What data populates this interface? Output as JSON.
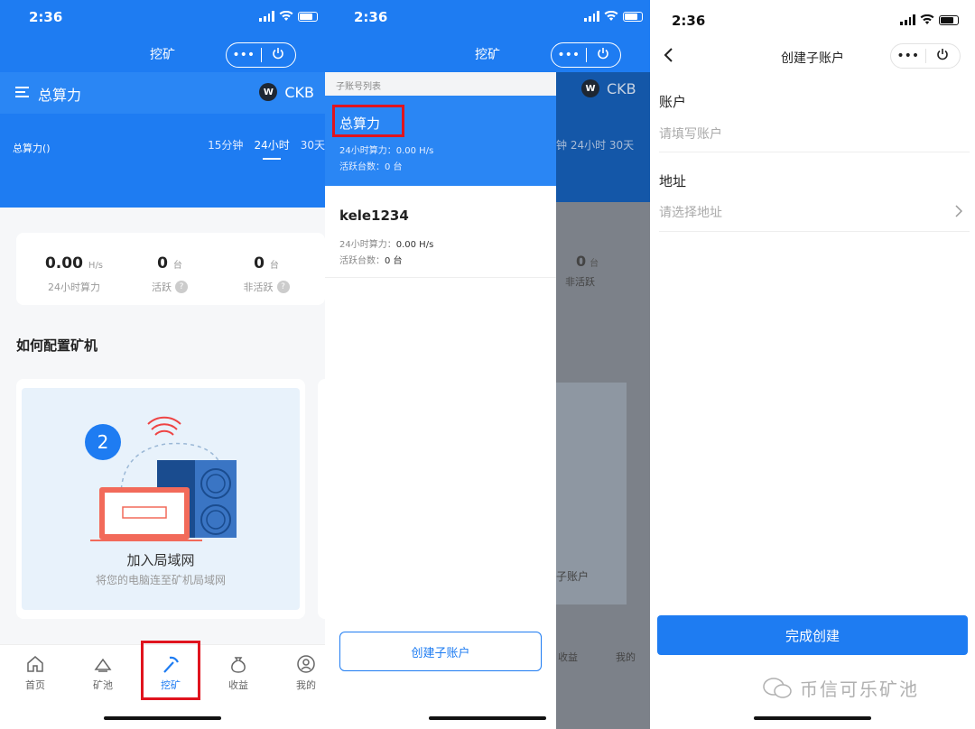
{
  "colors": {
    "primary": "#1e7cf2",
    "highlight": "#e0141e"
  },
  "status": {
    "time": "2:36"
  },
  "panel1": {
    "nav_title": "挖矿",
    "capsule_more": "•••",
    "topbar": {
      "title": "总算力",
      "coin": "CKB"
    },
    "hash_label": "总算力()",
    "time_tabs": [
      "15分钟",
      "24小时",
      "30天"
    ],
    "stats": [
      {
        "value": "0.00",
        "unit": "H/s",
        "label": "24小时算力"
      },
      {
        "value": "0",
        "unit": "台",
        "label": "活跃"
      },
      {
        "value": "0",
        "unit": "台",
        "label": "非活跃"
      }
    ],
    "section_title": "如何配置矿机",
    "guide": {
      "step": "2",
      "title": "加入局域网",
      "subtitle": "将您的电脑连至矿机局域网"
    },
    "tabbar": [
      {
        "label": "首页",
        "icon": "home-icon"
      },
      {
        "label": "矿池",
        "icon": "pool-icon"
      },
      {
        "label": "挖矿",
        "icon": "pickaxe-icon"
      },
      {
        "label": "收益",
        "icon": "money-bag-icon"
      },
      {
        "label": "我的",
        "icon": "user-icon"
      }
    ]
  },
  "panel2": {
    "nav_title": "挖矿",
    "drawer_title": "子账号列表",
    "accounts": [
      {
        "name": "总算力",
        "hash_label": "24小时算力：",
        "hash": "0.00 H/s",
        "active_label": "活跃台数：",
        "active": "0 台"
      },
      {
        "name": "kele1234",
        "hash_label": "24小时算力：",
        "hash": "0.00 H/s",
        "active_label": "活跃台数：",
        "active": "0 台"
      }
    ],
    "create_btn": "创建子账户",
    "overlay": {
      "coin": "CKB",
      "tabs": "钟 24小时 30天",
      "num": "0",
      "unit": "台",
      "lab": "非活跃",
      "text": "子账户",
      "tab1": "收益",
      "tab2": "我的"
    }
  },
  "panel3": {
    "nav_title": "创建子账户",
    "account_label": "账户",
    "account_placeholder": "请填写账户",
    "address_label": "地址",
    "address_placeholder": "请选择地址",
    "submit": "完成创建",
    "watermark": "币信可乐矿池"
  }
}
